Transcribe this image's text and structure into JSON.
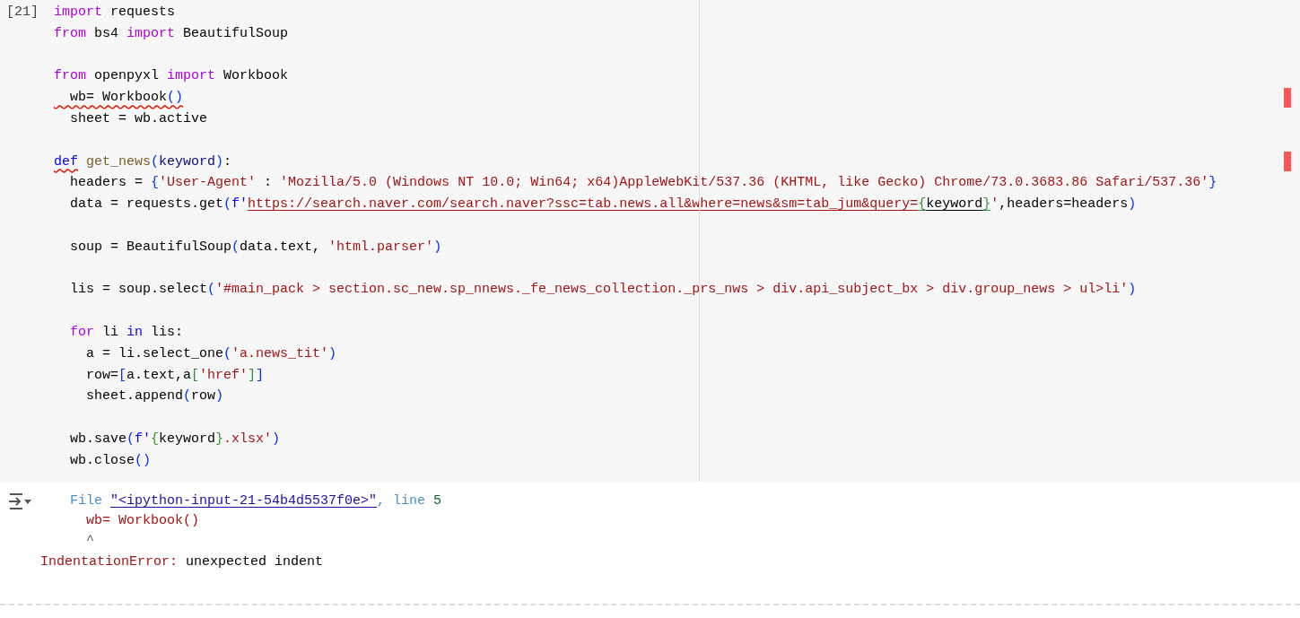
{
  "cell": {
    "execution_count": "[21]",
    "lines": [
      {
        "gap_before": false,
        "tokens": [
          {
            "text": "import",
            "kind": "kw"
          },
          {
            "text": " requests",
            "kind": "plain"
          }
        ]
      },
      {
        "gap_before": false,
        "tokens": [
          {
            "text": "from",
            "kind": "kw"
          },
          {
            "text": " bs4 ",
            "kind": "plain"
          },
          {
            "text": "import",
            "kind": "kw"
          },
          {
            "text": " BeautifulSoup",
            "kind": "plain"
          }
        ]
      },
      {
        "gap_before": true,
        "tokens": [
          {
            "text": "from",
            "kind": "kw"
          },
          {
            "text": " openpyxl ",
            "kind": "plain"
          },
          {
            "text": "import",
            "kind": "kw"
          },
          {
            "text": " Workbook",
            "kind": "plain"
          }
        ]
      },
      {
        "gap_before": false,
        "tokens": [
          {
            "text": "  wb= Workbook",
            "kind": "plain",
            "error": true
          },
          {
            "text": "()",
            "kind": "paren",
            "error": true
          }
        ]
      },
      {
        "gap_before": false,
        "tokens": [
          {
            "text": "  sheet = wb.active",
            "kind": "plain"
          }
        ]
      },
      {
        "gap_before": true,
        "tokens": [
          {
            "text": "def",
            "kind": "def",
            "error": true
          },
          {
            "text": " get_news",
            "kind": "fn"
          },
          {
            "text": "(",
            "kind": "paren"
          },
          {
            "text": "keyword",
            "kind": "param"
          },
          {
            "text": ")",
            "kind": "paren"
          },
          {
            "text": ":",
            "kind": "plain"
          }
        ]
      },
      {
        "gap_before": false,
        "tokens": [
          {
            "text": "  headers = ",
            "kind": "plain"
          },
          {
            "text": "{",
            "kind": "paren"
          },
          {
            "text": "'User-Agent'",
            "kind": "str"
          },
          {
            "text": " : ",
            "kind": "plain"
          },
          {
            "text": "'Mozilla/5.0 (Windows NT 10.0; Win64; x64)AppleWebKit/537.36 (KHTML, like Gecko) Chrome/73.0.3683.86 Safari/537.36'",
            "kind": "str"
          },
          {
            "text": "}",
            "kind": "paren"
          }
        ]
      },
      {
        "gap_before": false,
        "tokens": [
          {
            "text": "  data = requests.get",
            "kind": "plain"
          },
          {
            "text": "(",
            "kind": "paren"
          },
          {
            "text": "f'",
            "kind": "fstr"
          },
          {
            "text": "https://search.naver.com/search.naver?ssc=tab.news.all&where=news&sm=tab_jum&query=",
            "kind": "url"
          },
          {
            "text": "{",
            "kind": "brace",
            "underline": true
          },
          {
            "text": "keyword",
            "kind": "plain",
            "underline": true
          },
          {
            "text": "}",
            "kind": "brace",
            "underline": true
          },
          {
            "text": "'",
            "kind": "str"
          },
          {
            "text": ",headers=headers",
            "kind": "plain"
          },
          {
            "text": ")",
            "kind": "paren"
          }
        ]
      },
      {
        "gap_before": true,
        "tokens": [
          {
            "text": "  soup = BeautifulSoup",
            "kind": "plain"
          },
          {
            "text": "(",
            "kind": "paren"
          },
          {
            "text": "data.text, ",
            "kind": "plain"
          },
          {
            "text": "'html.parser'",
            "kind": "str"
          },
          {
            "text": ")",
            "kind": "paren"
          }
        ]
      },
      {
        "gap_before": true,
        "tokens": [
          {
            "text": "  lis = soup.select",
            "kind": "plain"
          },
          {
            "text": "(",
            "kind": "paren"
          },
          {
            "text": "'#main_pack > section.sc_new.sp_nnews._fe_news_collection._prs_nws > div.api_subject_bx > div.group_news > ul>li'",
            "kind": "str"
          },
          {
            "text": ")",
            "kind": "paren"
          }
        ]
      },
      {
        "gap_before": true,
        "tokens": [
          {
            "text": "  for",
            "kind": "kw"
          },
          {
            "text": " li ",
            "kind": "plain"
          },
          {
            "text": "in",
            "kind": "def"
          },
          {
            "text": " lis:",
            "kind": "plain"
          }
        ]
      },
      {
        "gap_before": false,
        "tokens": [
          {
            "text": "    a = li.select_one",
            "kind": "plain"
          },
          {
            "text": "(",
            "kind": "paren"
          },
          {
            "text": "'a.news_tit'",
            "kind": "str"
          },
          {
            "text": ")",
            "kind": "paren"
          }
        ]
      },
      {
        "gap_before": false,
        "tokens": [
          {
            "text": "    row=",
            "kind": "plain"
          },
          {
            "text": "[",
            "kind": "paren"
          },
          {
            "text": "a.text,a",
            "kind": "plain"
          },
          {
            "text": "[",
            "kind": "brace"
          },
          {
            "text": "'href'",
            "kind": "str"
          },
          {
            "text": "]",
            "kind": "brace"
          },
          {
            "text": "]",
            "kind": "paren"
          }
        ]
      },
      {
        "gap_before": false,
        "tokens": [
          {
            "text": "    sheet.append",
            "kind": "plain"
          },
          {
            "text": "(",
            "kind": "paren"
          },
          {
            "text": "row",
            "kind": "plain"
          },
          {
            "text": ")",
            "kind": "paren"
          }
        ]
      },
      {
        "gap_before": true,
        "tokens": [
          {
            "text": "  wb.save",
            "kind": "plain"
          },
          {
            "text": "(",
            "kind": "paren"
          },
          {
            "text": "f'",
            "kind": "fstr"
          },
          {
            "text": "{",
            "kind": "brace"
          },
          {
            "text": "keyword",
            "kind": "plain"
          },
          {
            "text": "}",
            "kind": "brace"
          },
          {
            "text": ".xlsx'",
            "kind": "str"
          },
          {
            "text": ")",
            "kind": "paren"
          }
        ]
      },
      {
        "gap_before": false,
        "tokens": [
          {
            "text": "  wb.close",
            "kind": "plain"
          },
          {
            "text": "()",
            "kind": "paren"
          }
        ]
      }
    ]
  },
  "output": {
    "lines": [
      {
        "tokens": [
          {
            "text": "  File ",
            "kind": "tb"
          },
          {
            "text": "\"<ipython-input-21-54b4d5537f0e>\"",
            "kind": "link"
          },
          {
            "text": ", line ",
            "kind": "tb"
          },
          {
            "text": "5",
            "kind": "num"
          }
        ]
      },
      {
        "tokens": [
          {
            "text": "    wb= Workbook()",
            "kind": "err"
          }
        ]
      },
      {
        "tokens": [
          {
            "text": "    ^",
            "kind": "caret"
          }
        ]
      },
      {
        "tokens": [
          {
            "text": "IndentationError:",
            "kind": "err"
          },
          {
            "text": " unexpected indent",
            "kind": "plain"
          }
        ]
      }
    ]
  }
}
